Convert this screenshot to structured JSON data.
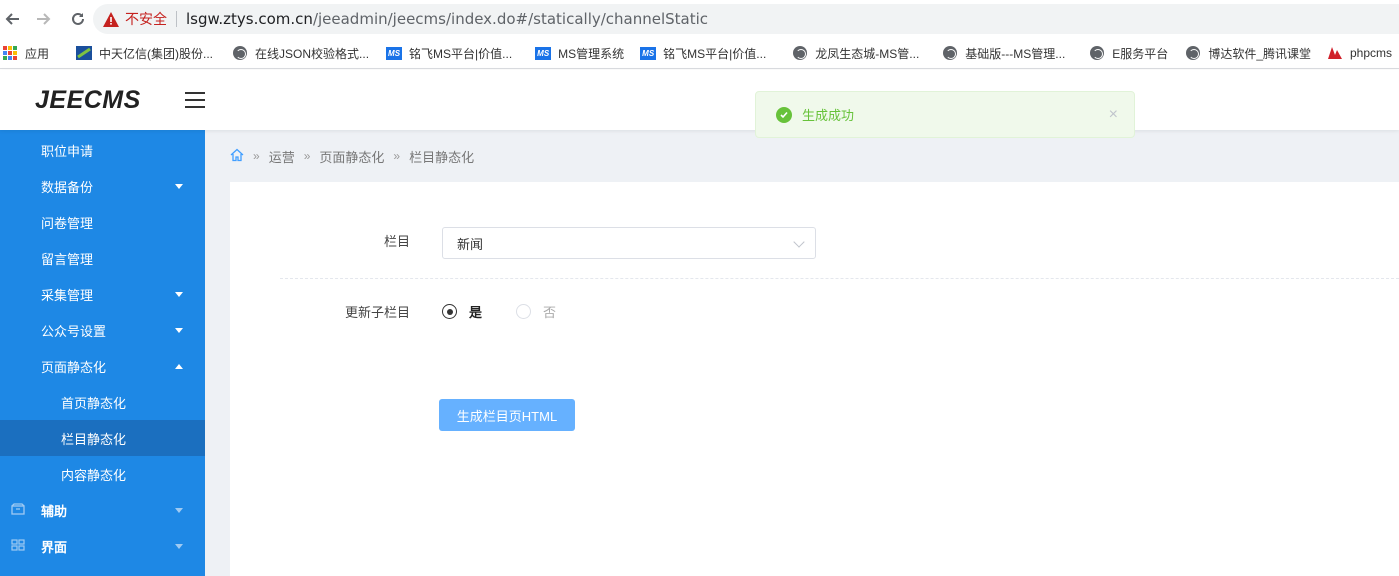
{
  "browser": {
    "security_label": "不安全",
    "url_host": "lsgw.ztys.com.cn",
    "url_path": "/jeeadmin/jeecms/index.do#/statically/channelStatic"
  },
  "bookmarks": [
    {
      "label": "应用",
      "icon": "apps-grid-icon"
    },
    {
      "label": "中天亿信(集团)股份...",
      "icon": "site-logo-icon"
    },
    {
      "label": "在线JSON校验格式...",
      "icon": "globe-icon"
    },
    {
      "label": "铭飞MS平台|价值...",
      "icon": "ms-logo-icon"
    },
    {
      "label": "MS管理系统",
      "icon": "ms-logo-icon"
    },
    {
      "label": "铭飞MS平台|价值...",
      "icon": "ms-logo-icon"
    },
    {
      "label": "龙凤生态城-MS管...",
      "icon": "globe-icon"
    },
    {
      "label": "基础版---MS管理...",
      "icon": "globe-icon"
    },
    {
      "label": "E服务平台",
      "icon": "globe-icon"
    },
    {
      "label": "博达软件_腾讯课堂",
      "icon": "globe-icon"
    },
    {
      "label": "phpcms",
      "icon": "phpcms-icon"
    }
  ],
  "app": {
    "logo": "JEECMS"
  },
  "toast": {
    "message": "生成成功",
    "close": "×"
  },
  "sidebar": {
    "items": [
      {
        "label": "职位申请"
      },
      {
        "label": "数据备份"
      },
      {
        "label": "问卷管理"
      },
      {
        "label": "留言管理"
      },
      {
        "label": "采集管理"
      },
      {
        "label": "公众号设置"
      },
      {
        "label": "页面静态化"
      },
      {
        "label": "首页静态化"
      },
      {
        "label": "栏目静态化"
      },
      {
        "label": "内容静态化"
      },
      {
        "label": "辅助"
      },
      {
        "label": "界面"
      }
    ]
  },
  "breadcrumb": {
    "items": [
      "运营",
      "页面静态化",
      "栏目静态化"
    ],
    "separator": "»"
  },
  "form": {
    "channel_label": "栏目",
    "channel_value": "新闻",
    "update_children_label": "更新子栏目",
    "option_yes": "是",
    "option_no": "否",
    "selected": "是",
    "submit_label": "生成栏目页HTML"
  },
  "colors": {
    "sidebar_bg": "#1e88e5",
    "sidebar_active": "#1b6fbf",
    "success": "#67c23a",
    "primary_button": "#66b1ff"
  }
}
